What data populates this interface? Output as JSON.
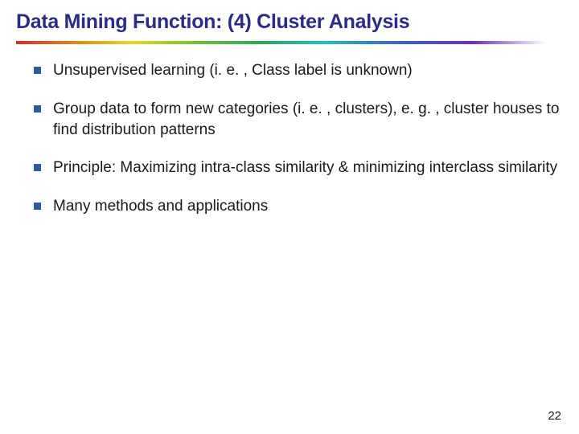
{
  "slide": {
    "title": "Data Mining Function: (4) Cluster Analysis",
    "bullets": [
      "Unsupervised learning (i. e. , Class label is unknown)",
      "Group data to form new categories (i. e. , clusters), e. g. , cluster houses to find distribution patterns",
      "Principle: Maximizing intra-class similarity & minimizing interclass similarity",
      "Many methods and applications"
    ],
    "page_number": "22"
  }
}
